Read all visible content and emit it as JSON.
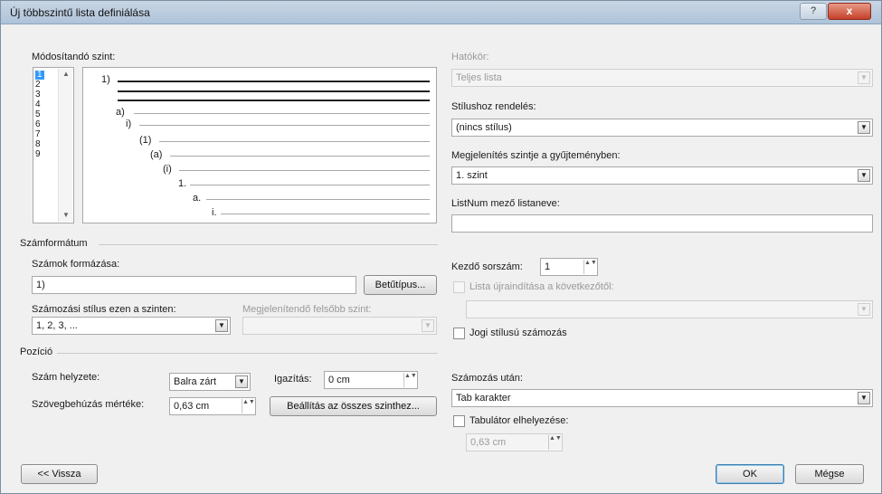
{
  "window": {
    "title": "Új többszintű lista definiálása",
    "help_label": "?",
    "close_label": "x"
  },
  "level_section": {
    "label": "Módosítandó szint:",
    "levels": [
      "1",
      "2",
      "3",
      "4",
      "5",
      "6",
      "7",
      "8",
      "9"
    ],
    "selected_level": "1"
  },
  "preview": {
    "items": [
      {
        "label": "1)"
      },
      {
        "label": "a)"
      },
      {
        "label": "i)"
      },
      {
        "label": "(1)"
      },
      {
        "label": "(a)"
      },
      {
        "label": "(i)"
      },
      {
        "label": "1."
      },
      {
        "label": "a."
      },
      {
        "label": "i."
      }
    ]
  },
  "right_panel": {
    "apply_to_label": "Hatókör:",
    "apply_to_value": "Teljes lista",
    "link_style_label": "Stílushoz rendelés:",
    "link_style_value": "(nincs stílus)",
    "gallery_level_label": "Megjelenítés szintje a gyűjteményben:",
    "gallery_level_value": "1. szint",
    "listnum_label": "ListNum mező listaneve:",
    "listnum_value": ""
  },
  "number_format": {
    "section_label": "Számformátum",
    "format_label": "Számok formázása:",
    "format_value": "1)",
    "font_button": "Betűtípus...",
    "style_label": "Számozási stílus ezen a szinten:",
    "style_value": "1, 2, 3, ...",
    "include_level_label": "Megjelenítendő felsőbb szint:",
    "include_level_value": "",
    "start_at_label": "Kezdő sorszám:",
    "start_at_value": "1",
    "restart_label": "Lista újraindítása a következőtől:",
    "restart_value": "",
    "legal_label": "Jogi stílusú számozás"
  },
  "position": {
    "section_label": "Pozíció",
    "alignment_label": "Szám helyzete:",
    "alignment_value": "Balra zárt",
    "aligned_at_label": "Igazítás:",
    "aligned_at_value": "0 cm",
    "indent_label": "Szövegbehúzás mértéke:",
    "indent_value": "0,63 cm",
    "set_all_button": "Beállítás az összes szinthez...",
    "follow_label": "Számozás után:",
    "follow_value": "Tab karakter",
    "tabstop_label": "Tabulátor elhelyezése:",
    "tabstop_value": "0,63 cm"
  },
  "footer": {
    "less_button": "<< Vissza",
    "ok_button": "OK",
    "cancel_button": "Mégse"
  },
  "icons": {
    "dropdown": "▼",
    "spin": "▲▼"
  }
}
